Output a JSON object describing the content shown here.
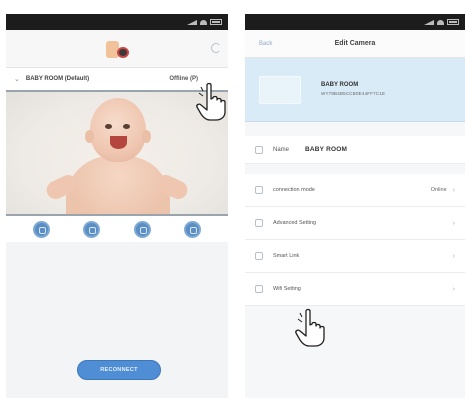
{
  "left_screen": {
    "camera_row": {
      "name": "BABY ROOM (Default)",
      "status": "Offline (P)"
    },
    "controls": [
      "record-icon",
      "snapshot-icon",
      "playback-icon",
      "talk-icon"
    ],
    "connect_button": "RECONNECT"
  },
  "right_screen": {
    "header": {
      "back": "Back",
      "title": "Edit Camera"
    },
    "device": {
      "name": "BABY ROOM",
      "id": "WY78B4B5CCB0E44FF7C1E"
    },
    "name_field": {
      "label": "Name",
      "value": "BABY ROOM"
    },
    "settings": [
      {
        "label": "connection mode",
        "value": "Online"
      },
      {
        "label": "Advanced Setting",
        "value": ""
      },
      {
        "label": "Smart Link",
        "value": ""
      },
      {
        "label": "Wifi Setting",
        "value": ""
      }
    ]
  },
  "colors": {
    "accent": "#4f8dd4",
    "card": "#d9ebf7",
    "statusbar": "#1c1c1c"
  }
}
